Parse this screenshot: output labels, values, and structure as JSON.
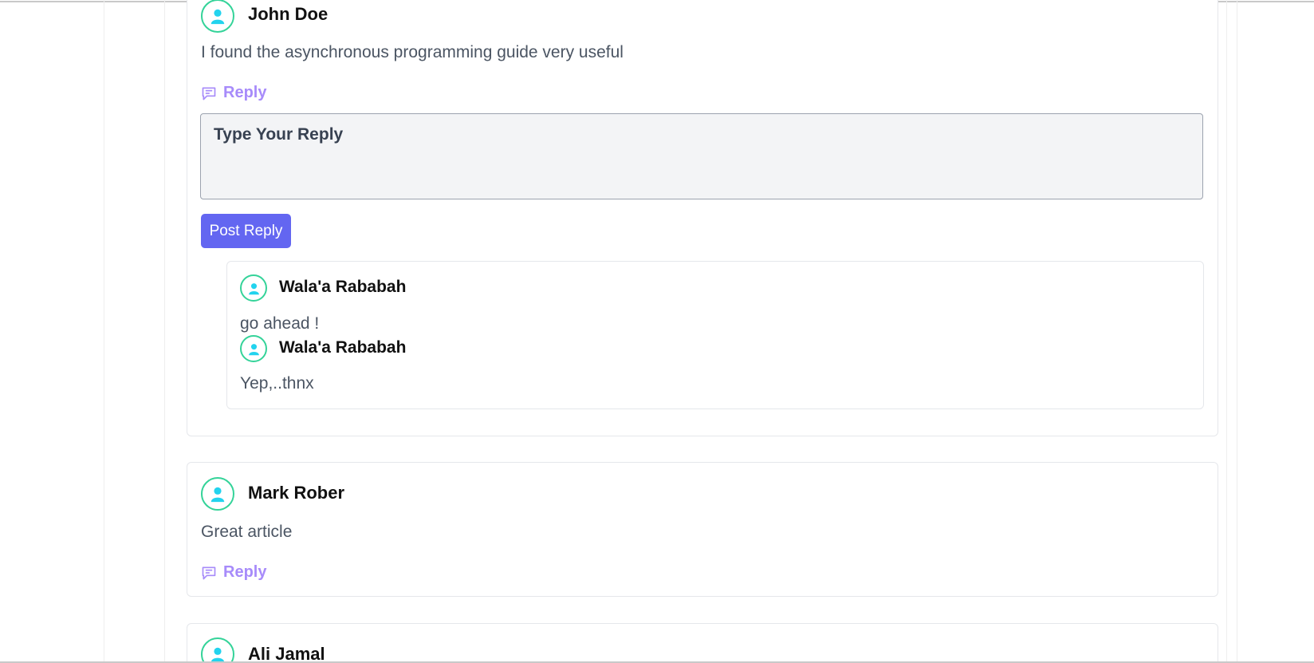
{
  "comments": [
    {
      "author": "John Doe",
      "text": "I found the asynchronous programming guide very useful",
      "reply_label": "Reply",
      "reply_form": {
        "placeholder": "Type Your Reply",
        "button_label": "Post Reply"
      },
      "replies": [
        {
          "author": "Wala'a Rababah",
          "text": "go ahead !"
        },
        {
          "author": "Wala'a Rababah",
          "text": "Yep,..thnx"
        }
      ]
    },
    {
      "author": "Mark Rober",
      "text": "Great article",
      "reply_label": "Reply"
    },
    {
      "author": "Ali Jamal"
    }
  ],
  "colors": {
    "accent": "#6366f1",
    "reply_link": "#a78bfa",
    "avatar_ring": "#34d399",
    "avatar_figure": "#22d3ee"
  },
  "icons": {
    "avatar": "user-circle-icon",
    "reply": "chat-bubble-icon"
  }
}
